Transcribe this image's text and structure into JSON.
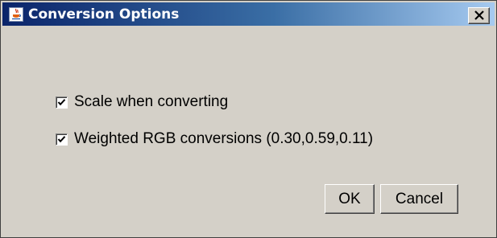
{
  "window": {
    "title": "Conversion Options",
    "icon": "java-cup-icon",
    "close_icon": "close-icon"
  },
  "options": [
    {
      "label": "Scale when converting",
      "checked": true
    },
    {
      "label": "Weighted RGB conversions (0.30,0.59,0.11)",
      "checked": true
    }
  ],
  "buttons": {
    "ok_label": "OK",
    "cancel_label": "Cancel"
  },
  "colors": {
    "title_gradient_start": "#0a246a",
    "title_gradient_end": "#a6caf0",
    "dialog_background": "#d4d0c8"
  }
}
